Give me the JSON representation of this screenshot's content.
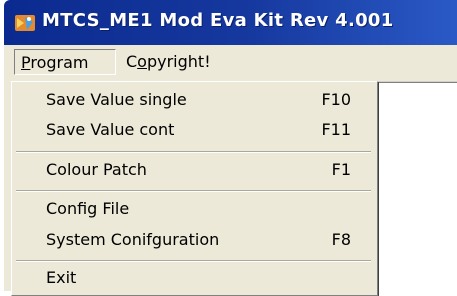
{
  "window": {
    "title": "MTCS_ME1 Mod Eva  Kit Rev  4.001",
    "icon": "app-icon"
  },
  "menubar": {
    "items": [
      {
        "label": "Program",
        "accel": "P",
        "rest": "rogram"
      },
      {
        "label": "Copyright!",
        "pre": "C",
        "accel": "o",
        "rest": "pyright!"
      }
    ]
  },
  "dropdown": {
    "items": [
      {
        "label": "Save Value single",
        "shortcut": "F10"
      },
      {
        "label": "Save Value cont",
        "shortcut": "F11"
      },
      {
        "label": "Colour Patch",
        "shortcut": "F1"
      },
      {
        "label": "Config File",
        "shortcut": ""
      },
      {
        "label": "System Conifguration",
        "shortcut": "F8"
      },
      {
        "label": "Exit",
        "shortcut": ""
      }
    ]
  },
  "colors": {
    "titlebar": "#0b2a8f",
    "menu_bg": "#ece9d8"
  }
}
